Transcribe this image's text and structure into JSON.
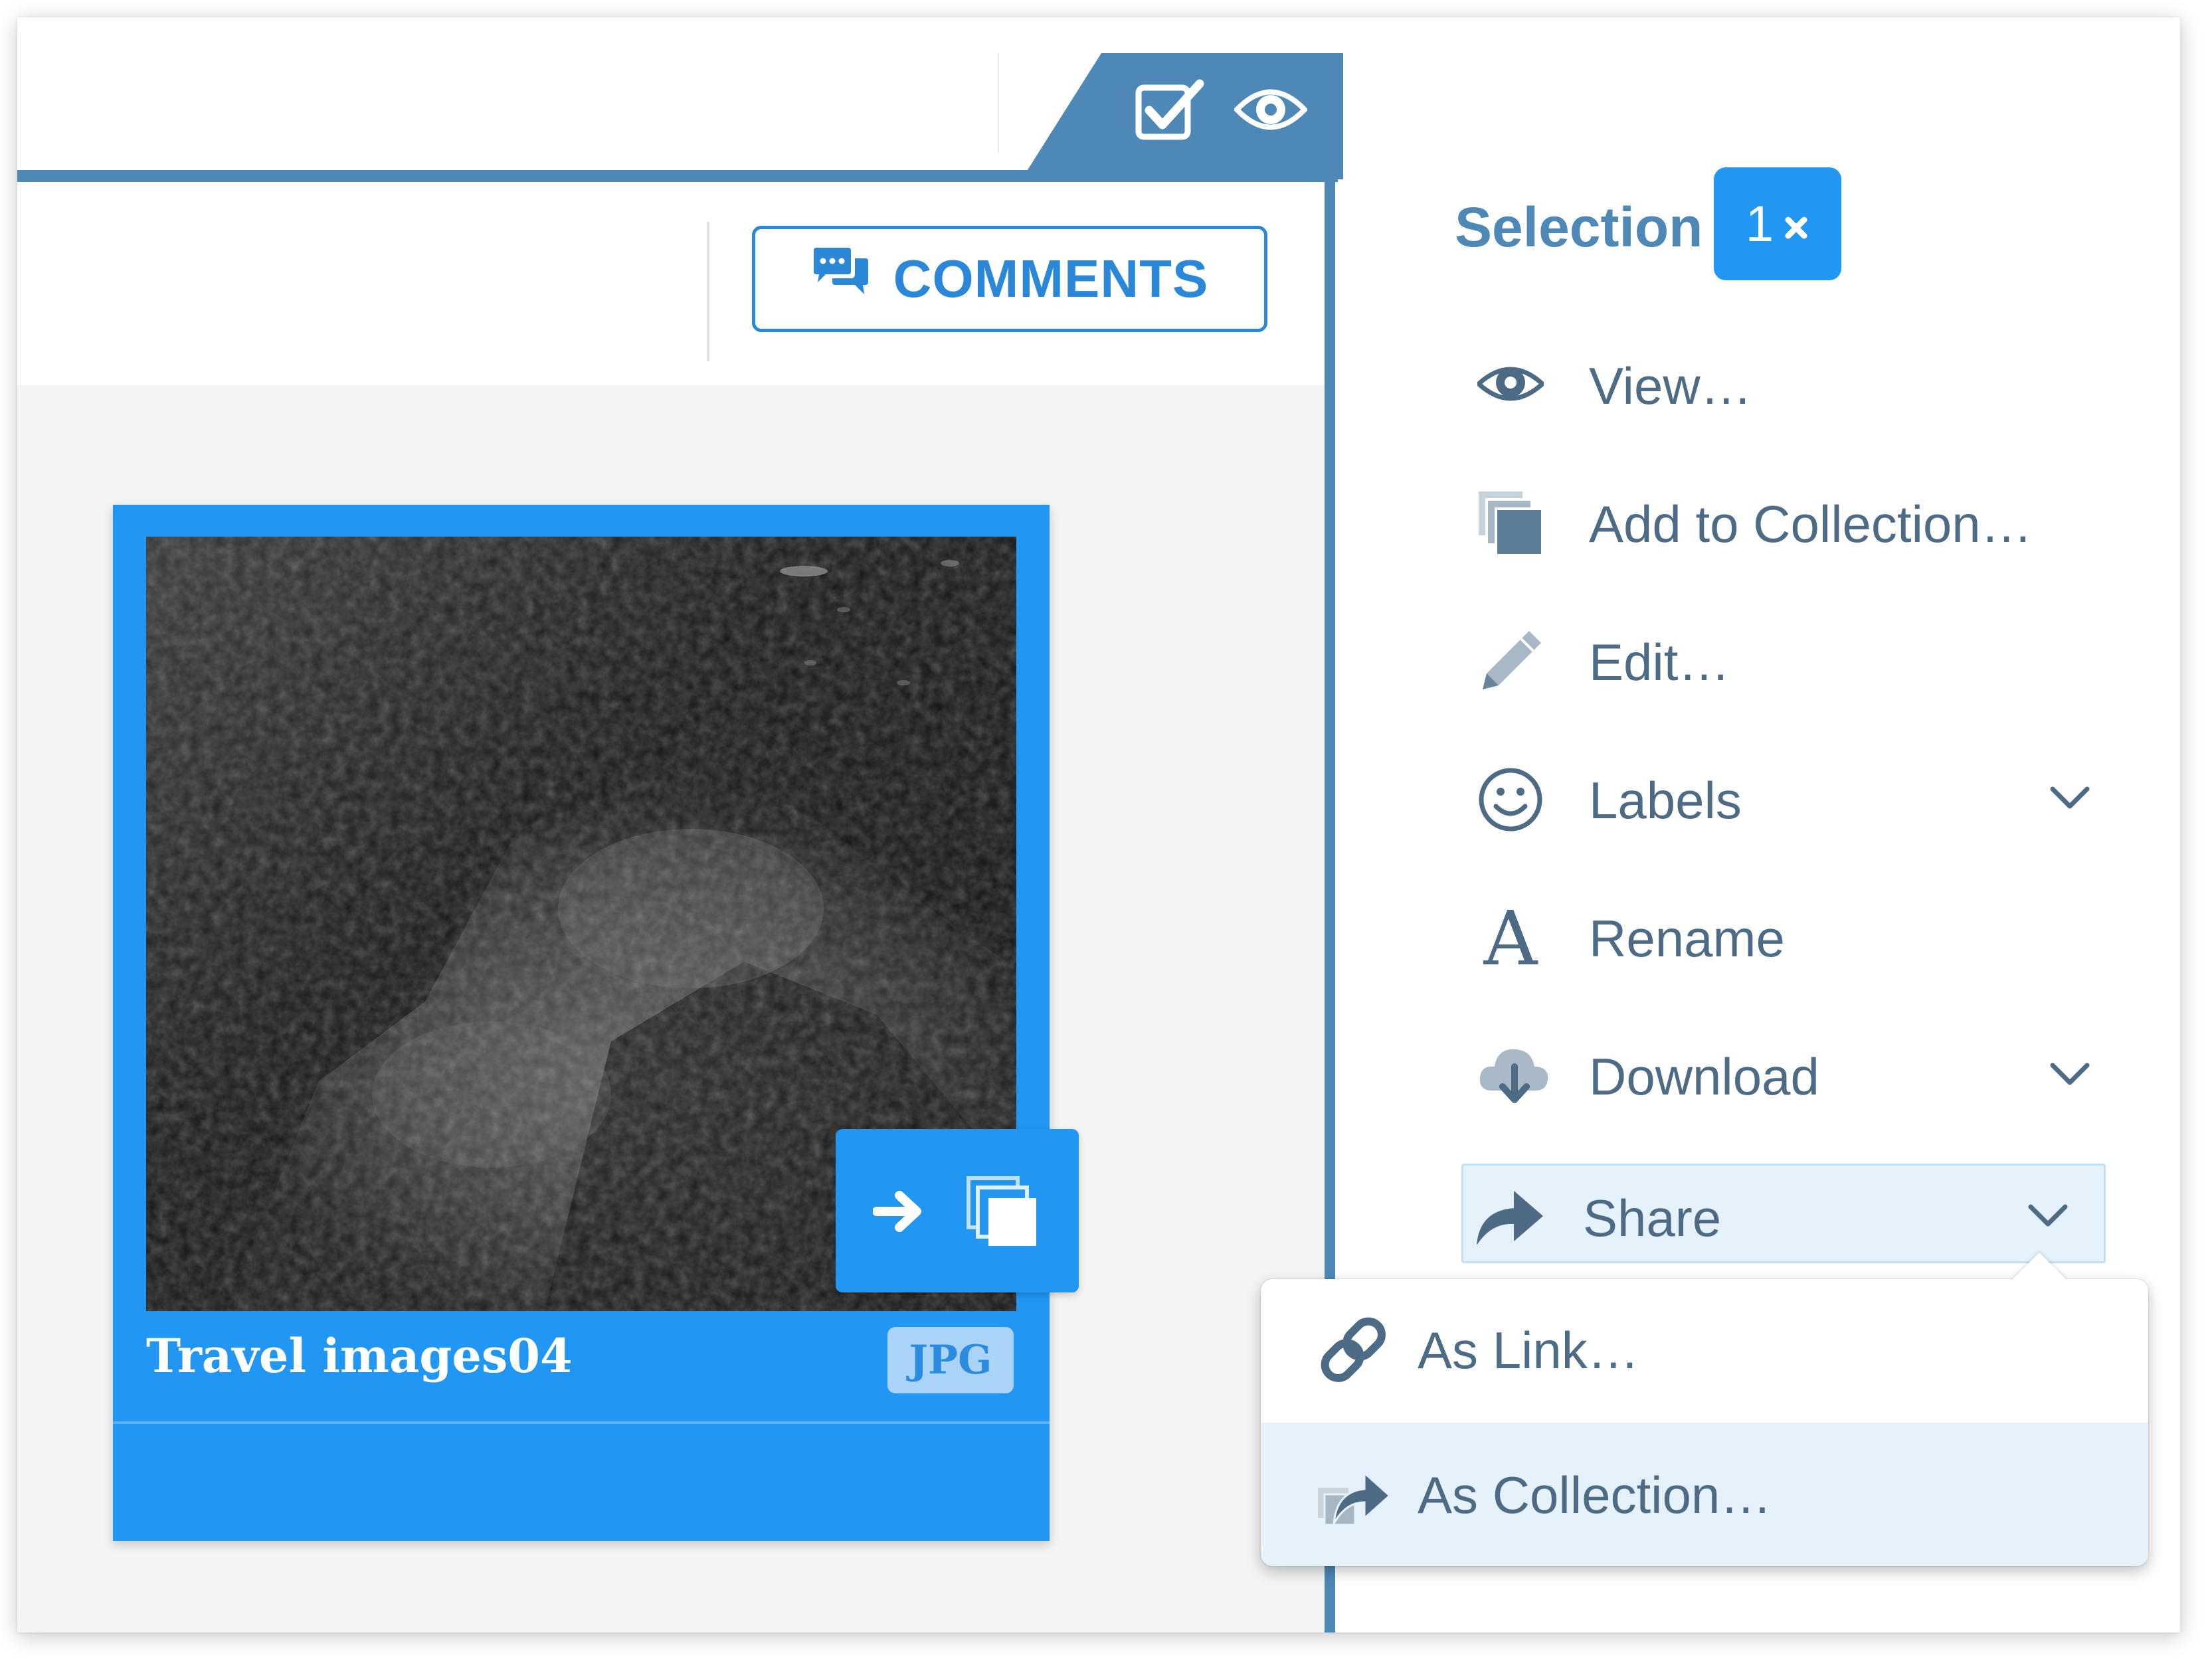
{
  "header": {
    "comments_label": "COMMENTS",
    "icons": [
      "check-square-icon",
      "eye-icon",
      "comment-bubbles-icon"
    ]
  },
  "card": {
    "title": "Travel images04",
    "filetype": "JPG",
    "actions": [
      "arrow-right-icon",
      "collection-stack-icon"
    ]
  },
  "selection": {
    "title": "Selection",
    "count": "1",
    "clear_icon": "close-icon"
  },
  "menu": [
    {
      "label": "View…",
      "icon": "eye-icon"
    },
    {
      "label": "Add to Collection…",
      "icon": "collection-stack-icon"
    },
    {
      "label": "Edit…",
      "icon": "pencil-icon"
    },
    {
      "label": "Labels",
      "icon": "smiley-icon"
    },
    {
      "label": "Rename",
      "icon": "letter-a-icon"
    },
    {
      "label": "Download",
      "icon": "cloud-download-icon"
    },
    {
      "label": "Share",
      "icon": "share-arrow-icon"
    }
  ],
  "share_submenu": [
    {
      "label": "As Link…",
      "icon": "link-icon"
    },
    {
      "label": "As Collection…",
      "icon": "share-collection-icon"
    }
  ],
  "colors": {
    "accent": "#2196f3",
    "panel_blue": "#4d88b6",
    "menu_text": "#4d6b84",
    "highlight": "#e6f2fb"
  }
}
